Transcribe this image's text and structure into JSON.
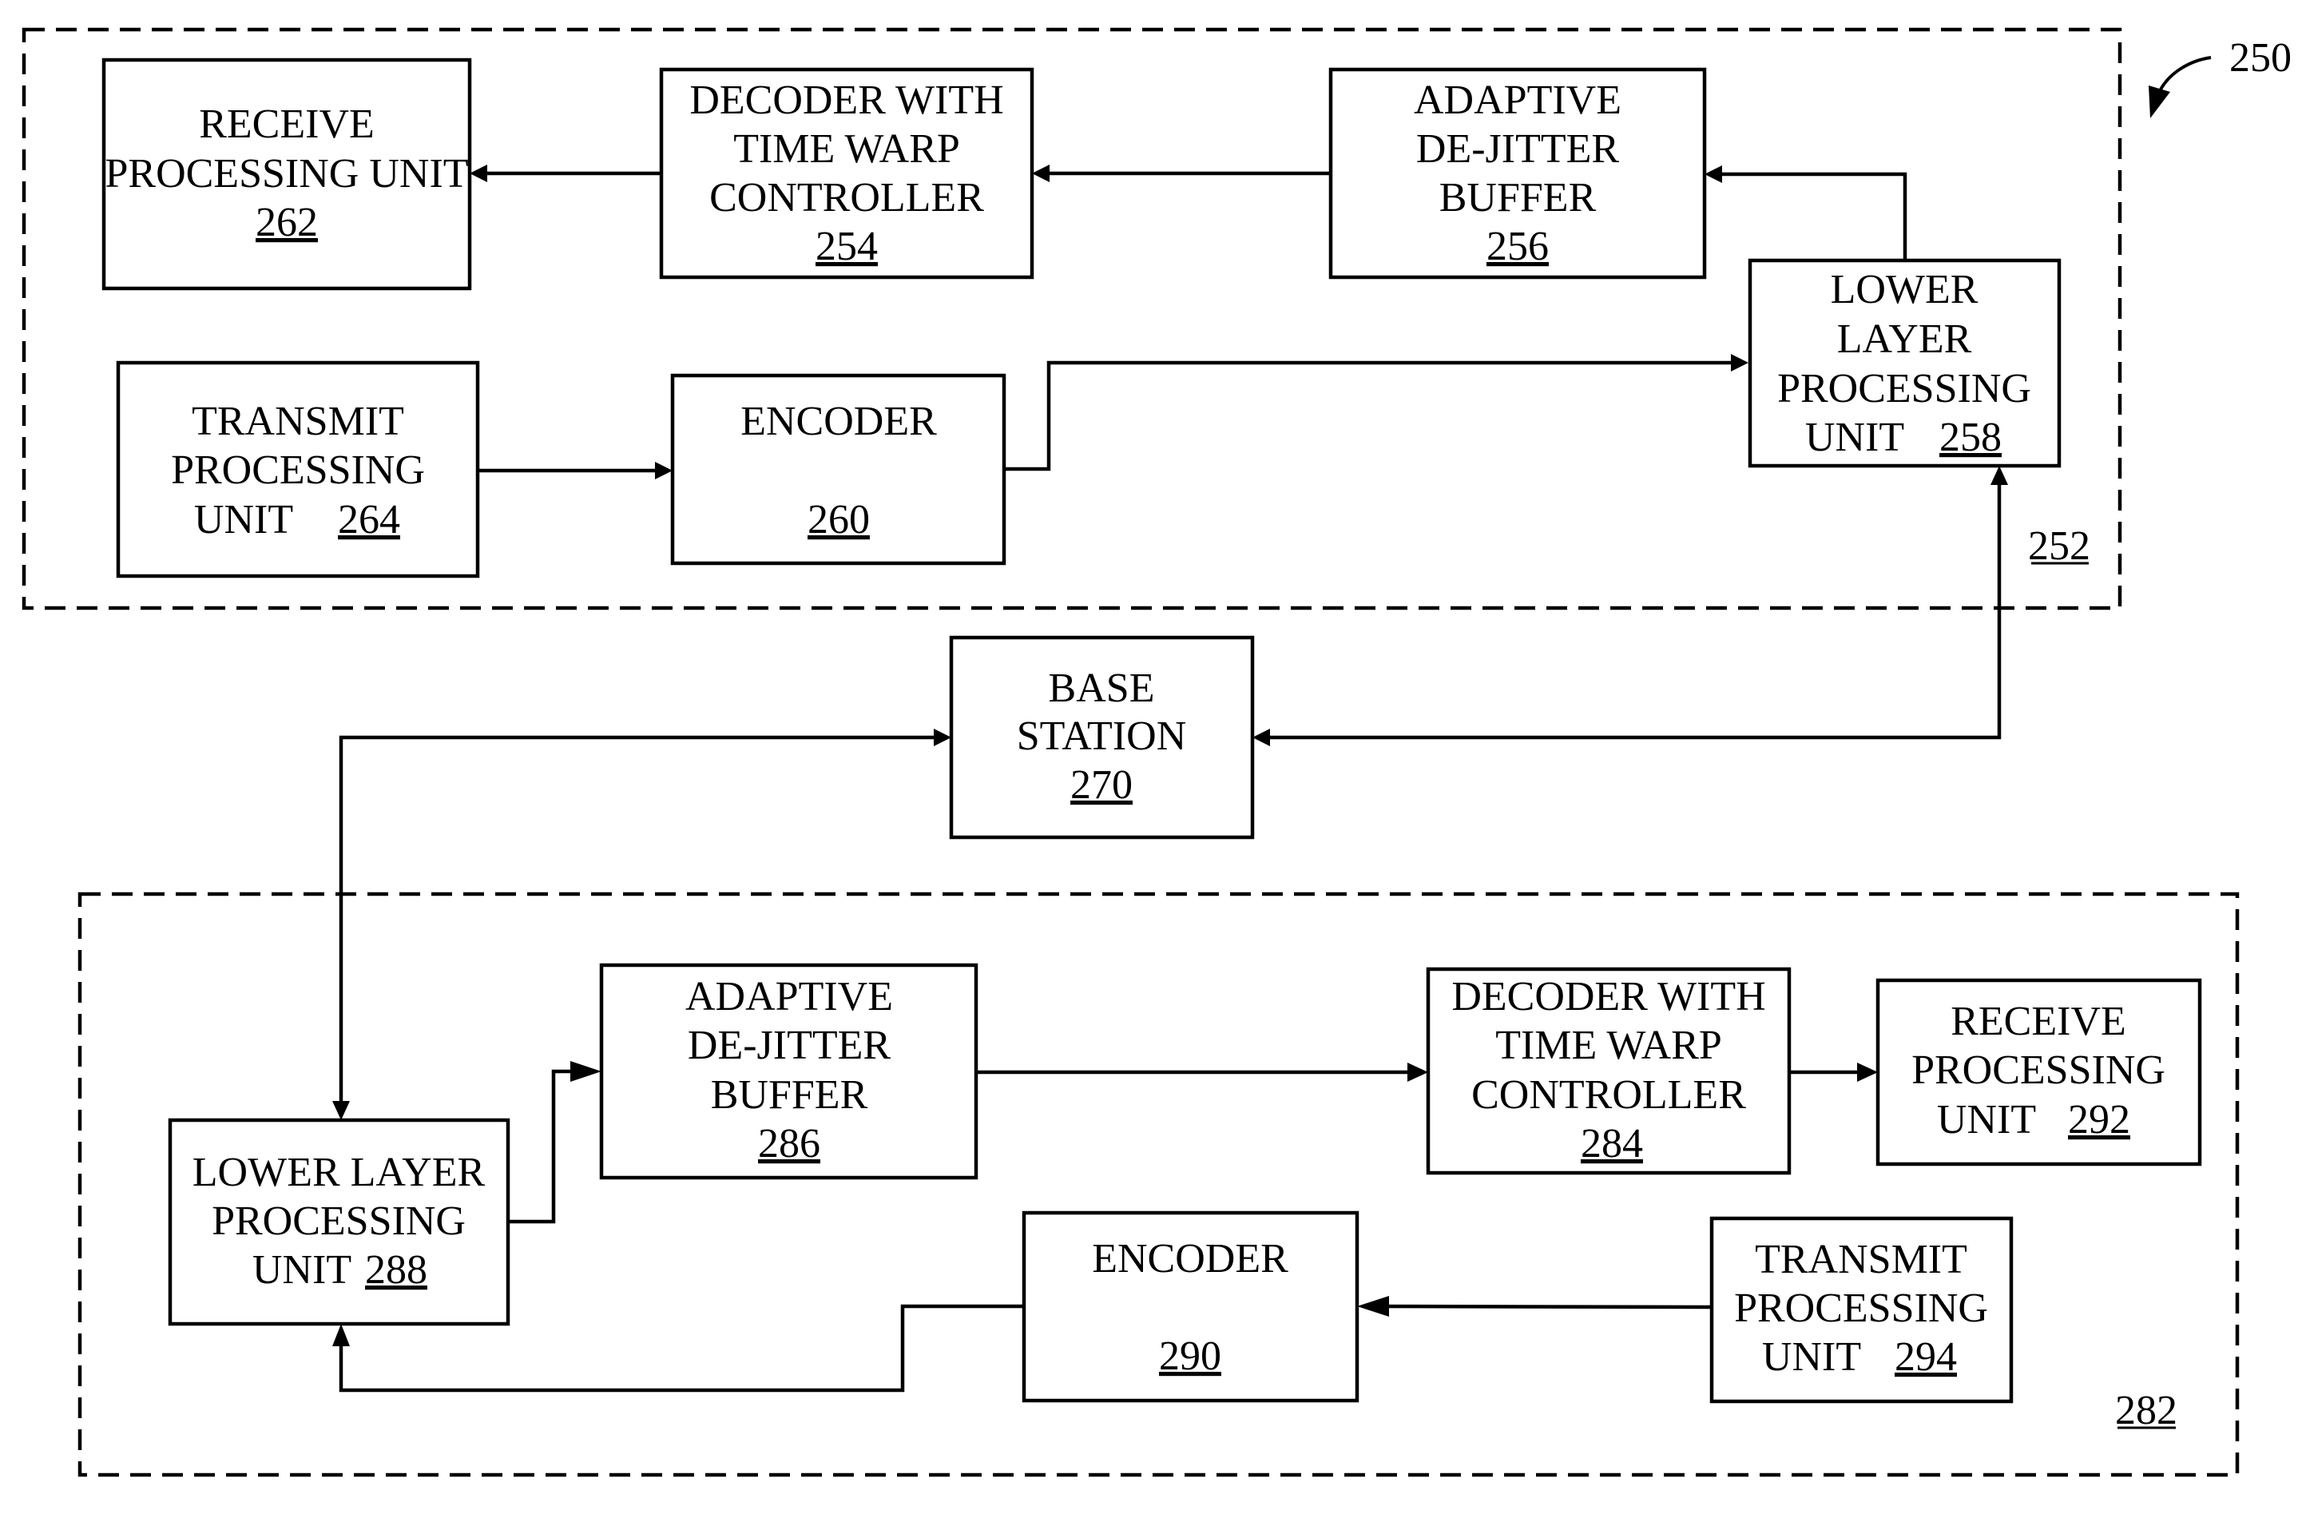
{
  "figure": {
    "reference": "250",
    "colors": {
      "ink": "#000000",
      "background": "#ffffff"
    }
  },
  "device_top": {
    "reference": "252",
    "blocks": {
      "receive": {
        "lines": [
          "RECEIVE",
          "PROCESSING UNIT"
        ],
        "ref": "262"
      },
      "decoder": {
        "lines": [
          "DECODER WITH",
          "TIME WARP",
          "CONTROLLER"
        ],
        "ref": "254"
      },
      "dejitter": {
        "lines": [
          "ADAPTIVE",
          "DE-JITTER",
          "BUFFER"
        ],
        "ref": "256"
      },
      "lower": {
        "lines": [
          "LOWER",
          "LAYER",
          "PROCESSING",
          "UNIT"
        ],
        "ref": "258"
      },
      "transmit": {
        "lines": [
          "TRANSMIT",
          "PROCESSING",
          "UNIT"
        ],
        "ref": "264"
      },
      "encoder": {
        "lines": [
          "ENCODER"
        ],
        "ref": "260"
      }
    }
  },
  "base_station": {
    "lines": [
      "BASE",
      "STATION"
    ],
    "ref": "270"
  },
  "device_bottom": {
    "reference": "282",
    "blocks": {
      "dejitter": {
        "lines": [
          "ADAPTIVE",
          "DE-JITTER",
          "BUFFER"
        ],
        "ref": "286"
      },
      "decoder": {
        "lines": [
          "DECODER WITH",
          "TIME WARP",
          "CONTROLLER"
        ],
        "ref": "284"
      },
      "receive": {
        "lines": [
          "RECEIVE",
          "PROCESSING",
          "UNIT"
        ],
        "ref": "292"
      },
      "lower": {
        "lines": [
          "LOWER LAYER",
          "PROCESSING",
          "UNIT"
        ],
        "ref": "288"
      },
      "encoder": {
        "lines": [
          "ENCODER"
        ],
        "ref": "290"
      },
      "transmit": {
        "lines": [
          "TRANSMIT",
          "PROCESSING",
          "UNIT"
        ],
        "ref": "294"
      }
    }
  },
  "connections": [
    {
      "from": "254",
      "to": "262"
    },
    {
      "from": "256",
      "to": "254"
    },
    {
      "from": "258",
      "to": "256"
    },
    {
      "from": "264",
      "to": "260"
    },
    {
      "from": "260",
      "to": "258"
    },
    {
      "from": "270",
      "to": "258",
      "bidirectional": true
    },
    {
      "from": "270",
      "to": "288",
      "bidirectional": true
    },
    {
      "from": "288",
      "to": "286"
    },
    {
      "from": "286",
      "to": "284"
    },
    {
      "from": "284",
      "to": "292"
    },
    {
      "from": "294",
      "to": "290"
    },
    {
      "from": "290",
      "to": "288"
    }
  ]
}
